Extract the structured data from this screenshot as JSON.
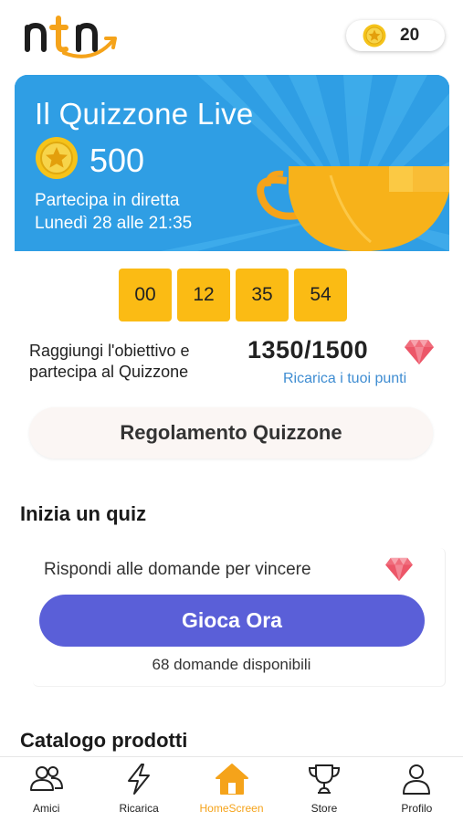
{
  "header": {
    "logo_icon": "ntn-logo-icon",
    "coin_balance": "20"
  },
  "quiz_card": {
    "title": "Il Quizzone Live",
    "prize": "500",
    "subtitle_line1": "Partecipa in diretta",
    "subtitle_line2": "Lunedì 28 alle 21:35",
    "bg_color": "#2f9ee4",
    "trophy_icon": "trophy-icon"
  },
  "countdown": [
    "00",
    "12",
    "35",
    "54"
  ],
  "goal": {
    "text": "Raggiungi l'obiettivo e partecipa al Quizzone",
    "score": "1350/1500",
    "recharge_link": "Ricarica i tuoi punti"
  },
  "rules_button": "Regolamento Quizzone",
  "start_quiz": {
    "section_title": "Inizia un quiz",
    "answer_line": "Rispondi alle domande per vincere",
    "play_button": "Gioca Ora",
    "questions_available": "68 domande disponibili",
    "play_color": "#5a5fd8"
  },
  "catalog": {
    "section_title": "Catalogo prodotti"
  },
  "nav": {
    "items": [
      {
        "label": "Amici",
        "icon": "friends-icon"
      },
      {
        "label": "Ricarica",
        "icon": "lightning-icon"
      },
      {
        "label": "HomeScreen",
        "icon": "home-icon"
      },
      {
        "label": "Store",
        "icon": "trophy-icon"
      },
      {
        "label": "Profilo",
        "icon": "profile-icon"
      }
    ],
    "active_color": "#f5a31a"
  }
}
